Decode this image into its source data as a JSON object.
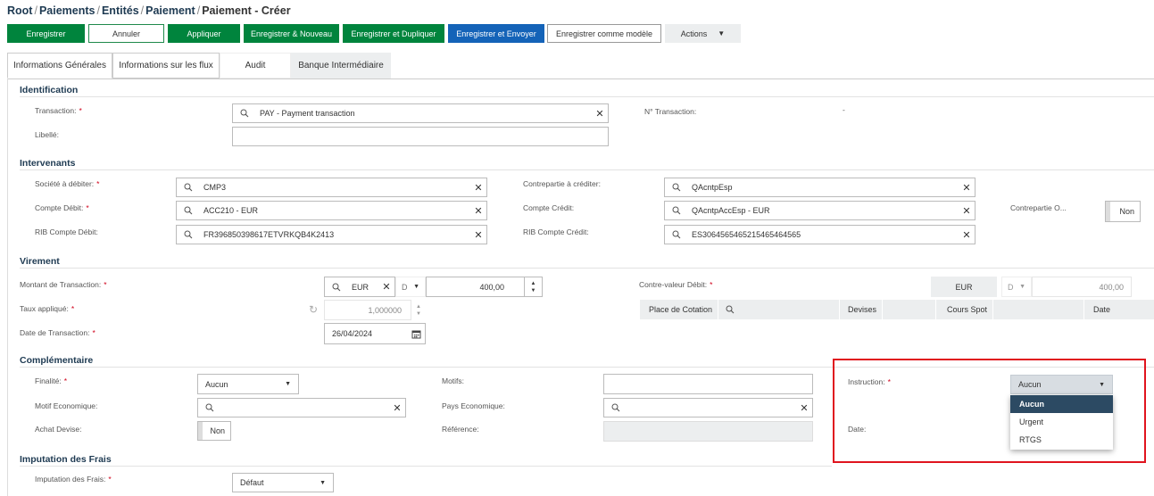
{
  "breadcrumb": {
    "items": [
      "Root",
      "Paiements",
      "Entités",
      "Paiement",
      "Paiement - Créer"
    ],
    "sep": "/"
  },
  "toolbar": {
    "save": "Enregistrer",
    "cancel": "Annuler",
    "apply": "Appliquer",
    "save_new": "Enregistrer & Nouveau",
    "save_duplicate": "Enregistrer et Dupliquer",
    "save_send": "Enregistrer et Envoyer",
    "save_template": "Enregistrer comme modèle",
    "actions": "Actions"
  },
  "tabs": [
    "Informations Générales",
    "Informations sur les flux",
    "Audit",
    "Banque Intermédiaire"
  ],
  "identification": {
    "title": "Identification",
    "transaction_label": "Transaction:",
    "transaction_value": "PAY - Payment transaction",
    "libelle_label": "Libellé:",
    "libelle_value": "",
    "no_transaction_label": "N° Transaction:",
    "no_transaction_value": "-"
  },
  "intervenants": {
    "title": "Intervenants",
    "societe_label": "Société à débiter:",
    "societe_value": "CMP3",
    "compte_debit_label": "Compte Débit:",
    "compte_debit_value": "ACC210 - EUR",
    "rib_debit_label": "RIB Compte Débit:",
    "rib_debit_value": "FR396850398617ETVRKQB4K2413",
    "contrepartie_label": "Contrepartie à créditer:",
    "contrepartie_value": "QAcntpEsp",
    "compte_credit_label": "Compte Crédit:",
    "compte_credit_value": "QAcntpAccEsp - EUR",
    "rib_credit_label": "RIB Compte Crédit:",
    "rib_credit_value": "ES3064565465215465464565",
    "contrepartie_o_label": "Contrepartie O...",
    "contrepartie_o_value": "Non"
  },
  "virement": {
    "title": "Virement",
    "montant_label": "Montant de Transaction:",
    "currency": "EUR",
    "dc": "D",
    "amount": "400,00",
    "taux_label": "Taux appliqué:",
    "taux_value": "1,000000",
    "date_label": "Date de Transaction:",
    "date_value": "26/04/2024",
    "contre_valeur_label": "Contre-valeur Débit:",
    "cv_currency": "EUR",
    "cv_dc": "D",
    "cv_amount": "400,00",
    "grid_headers": [
      "Place de Cotation",
      "Devises",
      "Cours Spot",
      "Date"
    ]
  },
  "complementaire": {
    "title": "Complémentaire",
    "finalite_label": "Finalité:",
    "finalite_value": "Aucun",
    "motif_eco_label": "Motif Economique:",
    "achat_devise_label": "Achat Devise:",
    "achat_devise_value": "Non",
    "motifs_label": "Motifs:",
    "pays_eco_label": "Pays Economique:",
    "reference_label": "Référence:",
    "instruction_label": "Instruction:",
    "instruction_value": "Aucun",
    "instruction_options": [
      "Aucun",
      "Urgent",
      "RTGS"
    ],
    "date_label": "Date:"
  },
  "frais": {
    "title": "Imputation des Frais",
    "label": "Imputation des Frais:",
    "value": "Défaut"
  },
  "colors": {
    "green": "#00843d",
    "blue": "#1463b8",
    "navy": "#1e3a52",
    "highlight": "#e0141e",
    "dropdown_active": "#2c4a63"
  }
}
